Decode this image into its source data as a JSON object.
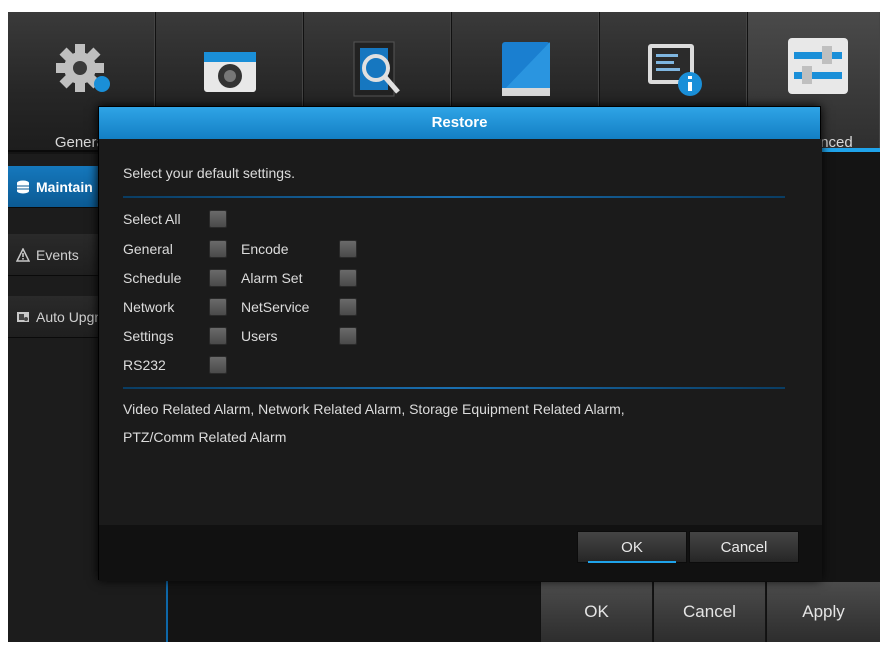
{
  "tabs": [
    {
      "label": "General",
      "icon": "gear-icon"
    },
    {
      "label": "",
      "icon": "camera-icon"
    },
    {
      "label": "",
      "icon": "search-film-icon"
    },
    {
      "label": "",
      "icon": "storage-icon"
    },
    {
      "label": "",
      "icon": "system-info-icon"
    },
    {
      "label": "Advanced",
      "icon": "sliders-icon"
    }
  ],
  "sidebar": {
    "items": [
      {
        "label": "Maintain",
        "icon": "database-icon"
      },
      {
        "label": "Events",
        "icon": "warning-icon"
      },
      {
        "label": "Auto Upgrade",
        "icon": "upgrade-icon"
      }
    ]
  },
  "bottom": {
    "ok": "OK",
    "cancel": "Cancel",
    "apply": "Apply"
  },
  "dialog": {
    "title": "Restore",
    "prompt": "Select your default settings.",
    "options": {
      "select_all": "Select All",
      "general": "General",
      "encode": "Encode",
      "schedule": "Schedule",
      "alarm_set": "Alarm Set",
      "network": "Network",
      "netservice": "NetService",
      "settings": "Settings",
      "users": "Users",
      "rs232": "RS232"
    },
    "alarm_line1": "Video Related Alarm, Network Related Alarm, Storage Equipment Related Alarm,",
    "alarm_line2": "PTZ/Comm Related Alarm",
    "ok": "OK",
    "cancel": "Cancel"
  },
  "colors": {
    "accent": "#1fa3ea",
    "title_bar": "#1b8ad2",
    "background": "#141414"
  }
}
